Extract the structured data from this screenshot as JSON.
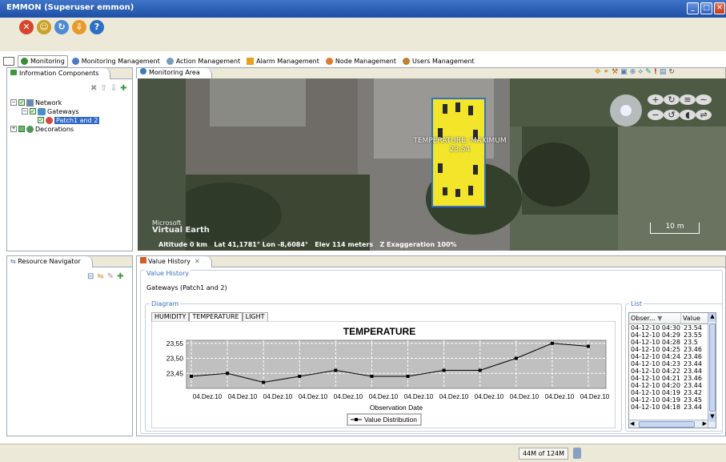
{
  "window": {
    "title": "EMMON (Superuser emmon)"
  },
  "perspectives": [
    {
      "label": "Monitoring",
      "icon": "globe-icon",
      "active": true
    },
    {
      "label": "Monitoring Management",
      "icon": "magnifier-icon"
    },
    {
      "label": "Action Management",
      "icon": "gear-search-icon"
    },
    {
      "label": "Alarm Management",
      "icon": "warning-icon"
    },
    {
      "label": "Node Management",
      "icon": "node-icon"
    },
    {
      "label": "Users Management",
      "icon": "users-icon"
    }
  ],
  "info_panel": {
    "title": "Information Components",
    "tree": {
      "network": "Network",
      "gateways": "Gateways",
      "patch": "Patch1 and 2",
      "decorations": "Decorations"
    }
  },
  "resource_panel": {
    "title": "Resource Navigator"
  },
  "map_panel": {
    "title": "Monitoring Area",
    "overlay_label": "TEMPERATURE: MAXIMUM",
    "overlay_value": "23.54",
    "brand_line1": "Microsoft",
    "brand_line2": "Virtual Earth",
    "status_line": "Altitude 0 km   Lat 41,1781° Lon -8,6084°   Elev 114 meters   Z Exaggeration 100%",
    "scale_label": "10 m"
  },
  "value_history": {
    "tab_title": "Value History",
    "section_title": "Value History",
    "subtitle": "Gateways (Patch1 and 2)",
    "diagram_label": "Diagram",
    "list_label": "List",
    "tabs": [
      "HUMIDITY",
      "TEMPERATURE",
      "LIGHT"
    ],
    "active_tab": "TEMPERATURE",
    "list_headers": {
      "obs": "Obser...",
      "value": "Value"
    },
    "list_rows": [
      {
        "date": "04-12-10 04:30",
        "value": "23.54"
      },
      {
        "date": "04-12-10 04:29",
        "value": "23.55"
      },
      {
        "date": "04-12-10 04:28",
        "value": "23.5"
      },
      {
        "date": "04-12-10 04:25",
        "value": "23.46"
      },
      {
        "date": "04-12-10 04:24",
        "value": "23.46"
      },
      {
        "date": "04-12-10 04:23",
        "value": "23.44"
      },
      {
        "date": "04-12-10 04:22",
        "value": "23.44"
      },
      {
        "date": "04-12-10 04:21",
        "value": "23.46"
      },
      {
        "date": "04-12-10 04:20",
        "value": "23.44"
      },
      {
        "date": "04-12-10 04:19",
        "value": "23.42"
      },
      {
        "date": "04-12-10 04:19",
        "value": "23.45"
      },
      {
        "date": "04-12-10 04:18",
        "value": "23.44"
      }
    ]
  },
  "chart_data": {
    "type": "line",
    "title": "TEMPERATURE",
    "xlabel": "Observation Date",
    "ylabel": "",
    "x_tick_labels": [
      "04.Dez.10",
      "04.Dez.10",
      "04.Dez.10",
      "04.Dez.10",
      "04.Dez.10",
      "04.Dez.10",
      "04.Dez.10",
      "04.Dez.10",
      "04.Dez.10",
      "04.Dez.10",
      "04.Dez.10",
      "04.Dez.10"
    ],
    "y_ticks": [
      "23,45",
      "23,50",
      "23,55"
    ],
    "ylim": [
      23.4,
      23.56
    ],
    "grid": true,
    "legend": "bottom",
    "series": [
      {
        "name": "Value Distribution",
        "values": [
          23.44,
          23.45,
          23.42,
          23.44,
          23.46,
          23.44,
          23.44,
          23.46,
          23.46,
          23.5,
          23.55,
          23.54
        ]
      }
    ]
  },
  "status": {
    "memory": "44M of 124M"
  },
  "colors": {
    "title_bar": "#2a5bb5",
    "chrome": "#ece9d8",
    "plot_bg": "#c0c0c0",
    "overlay": "#f2e52a",
    "frame_label": "#3a6fc0"
  }
}
